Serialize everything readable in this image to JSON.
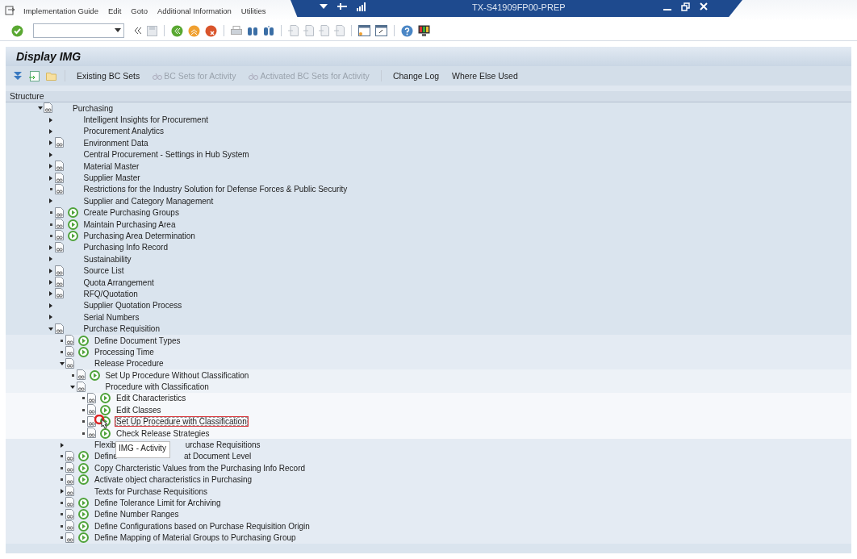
{
  "menu_bar": {
    "items": [
      "Implementation Guide",
      "Edit",
      "Goto",
      "Additional Information",
      "Utilities"
    ]
  },
  "title_bar": {
    "title": "TX-S41909FP00-PREP"
  },
  "page_title": "Display IMG",
  "app_toolbar": [
    {
      "label": "Existing BC Sets",
      "kind": "plain",
      "disabled": false
    },
    {
      "label": "BC Sets for Activity",
      "kind": "with-icon",
      "disabled": true
    },
    {
      "label": "Activated BC Sets for Activity",
      "kind": "with-icon",
      "disabled": true
    },
    {
      "label": "Change Log",
      "kind": "plain",
      "disabled": false
    },
    {
      "label": "Where Else Used",
      "kind": "plain",
      "disabled": false
    }
  ],
  "tree": {
    "header": "Structure",
    "tooltip": "IMG - Activity",
    "items": [
      {
        "label": "Purchasing",
        "kind": "folder",
        "expanded": true,
        "doc": true,
        "activity": false,
        "children": [
          {
            "label": "Intelligent Insights for Procurement",
            "kind": "folder",
            "expanded": false,
            "doc": false,
            "activity": false
          },
          {
            "label": "Procurement Analytics",
            "kind": "folder",
            "expanded": false,
            "doc": false,
            "activity": false
          },
          {
            "label": "Environment Data",
            "kind": "folder",
            "expanded": false,
            "doc": true,
            "activity": false
          },
          {
            "label": "Central Procurement - Settings in Hub System",
            "kind": "folder",
            "expanded": false,
            "doc": false,
            "activity": false
          },
          {
            "label": "Material Master",
            "kind": "folder",
            "expanded": false,
            "doc": true,
            "activity": false
          },
          {
            "label": "Supplier Master",
            "kind": "folder",
            "expanded": false,
            "doc": true,
            "activity": false
          },
          {
            "label": "Restrictions for the Industry Solution for Defense Forces & Public Security",
            "kind": "leaf",
            "doc": true,
            "activity": false
          },
          {
            "label": "Supplier and Category Management",
            "kind": "folder",
            "expanded": false,
            "doc": false,
            "activity": false
          },
          {
            "label": "Create Purchasing Groups",
            "kind": "leaf",
            "doc": true,
            "activity": true
          },
          {
            "label": "Maintain Purchasing Area",
            "kind": "leaf",
            "doc": true,
            "activity": true
          },
          {
            "label": "Purchasing Area Determination",
            "kind": "leaf",
            "doc": true,
            "activity": true
          },
          {
            "label": "Purchasing Info Record",
            "kind": "folder",
            "expanded": false,
            "doc": true,
            "activity": false
          },
          {
            "label": "Sustainability",
            "kind": "folder",
            "expanded": false,
            "doc": false,
            "activity": false
          },
          {
            "label": "Source List",
            "kind": "folder",
            "expanded": false,
            "doc": true,
            "activity": false
          },
          {
            "label": "Quota Arrangement",
            "kind": "folder",
            "expanded": false,
            "doc": true,
            "activity": false
          },
          {
            "label": "RFQ/Quotation",
            "kind": "folder",
            "expanded": false,
            "doc": true,
            "activity": false
          },
          {
            "label": "Supplier Quotation Process",
            "kind": "folder",
            "expanded": false,
            "doc": false,
            "activity": false
          },
          {
            "label": "Serial Numbers",
            "kind": "folder",
            "expanded": false,
            "doc": false,
            "activity": false
          },
          {
            "label": "Purchase Requisition",
            "kind": "folder",
            "expanded": true,
            "doc": true,
            "activity": false,
            "children": [
              {
                "label": "Define Document Types",
                "kind": "leaf",
                "doc": true,
                "activity": true
              },
              {
                "label": "Processing Time",
                "kind": "leaf",
                "doc": true,
                "activity": true
              },
              {
                "label": "Release Procedure",
                "kind": "folder",
                "expanded": true,
                "doc": true,
                "activity": false,
                "children": [
                  {
                    "label": "Set Up Procedure Without Classification",
                    "kind": "leaf",
                    "doc": true,
                    "activity": true
                  },
                  {
                    "label": "Procedure with Classification",
                    "kind": "folder",
                    "expanded": true,
                    "doc": true,
                    "activity": false,
                    "children": [
                      {
                        "label": "Edit Characteristics",
                        "kind": "leaf",
                        "doc": true,
                        "activity": true,
                        "selected": false
                      },
                      {
                        "label": "Edit Classes",
                        "kind": "leaf",
                        "doc": true,
                        "activity": true,
                        "selected": false
                      },
                      {
                        "label": "Set Up Procedure with Classification",
                        "kind": "leaf",
                        "doc": true,
                        "activity": true,
                        "selected": true
                      },
                      {
                        "label": "Check Release Strategies",
                        "kind": "leaf",
                        "doc": true,
                        "activity": true,
                        "selected": false
                      }
                    ]
                  }
                ]
              },
              {
                "label_parts": [
                  "Flexib",
                  "urchase Requisitions"
                ],
                "kind": "folder",
                "expanded": false,
                "doc": false,
                "activity": false
              },
              {
                "label_parts": [
                  "Define",
                  "at Document Level"
                ],
                "kind": "leaf",
                "doc": true,
                "activity": true
              },
              {
                "label": "Copy Charcteristic Values from the Purchasing Info Record",
                "kind": "leaf",
                "doc": true,
                "activity": true
              },
              {
                "label": "Activate object characteristics in Purchasing",
                "kind": "leaf",
                "doc": true,
                "activity": true
              },
              {
                "label": "Texts for Purchase Requisitions",
                "kind": "folder",
                "expanded": false,
                "doc": true,
                "activity": false
              },
              {
                "label": "Define Tolerance Limit for Archiving",
                "kind": "leaf",
                "doc": true,
                "activity": true
              },
              {
                "label": "Define Number Ranges",
                "kind": "leaf",
                "doc": true,
                "activity": true
              },
              {
                "label": "Define Configurations based on Purchase Requisition Origin",
                "kind": "leaf",
                "doc": true,
                "activity": true
              },
              {
                "label": "Define Mapping of Material Groups to Purchasing Group",
                "kind": "leaf",
                "doc": true,
                "activity": true
              }
            ]
          }
        ]
      }
    ]
  }
}
